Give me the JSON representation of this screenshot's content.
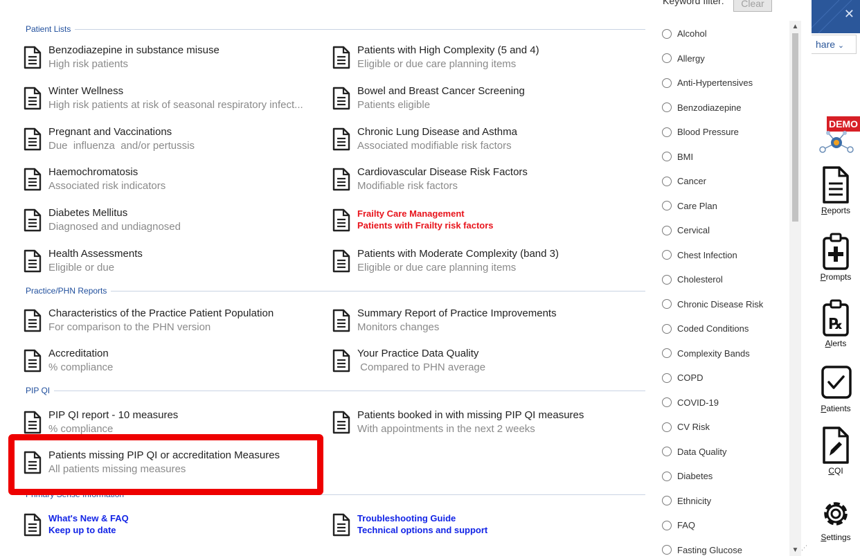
{
  "sections": {
    "patient_lists": "Patient Lists",
    "practice_phn": "Practice/PHN Reports",
    "pip_qi": "PIP QI",
    "primary_sense": "Primary Sense Information"
  },
  "reports": {
    "benzo": {
      "title": "Benzodiazepine in substance misuse",
      "subtitle": "High risk patients"
    },
    "winter": {
      "title": "Winter Wellness",
      "subtitle": "High risk patients at risk of seasonal respiratory infect..."
    },
    "pregnant": {
      "title": "Pregnant and Vaccinations",
      "subtitle": "Due  influenza  and/or pertussis"
    },
    "haemo": {
      "title": "Haemochromatosis",
      "subtitle": "Associated risk indicators"
    },
    "diabetes": {
      "title": "Diabetes Mellitus",
      "subtitle": "Diagnosed and undiagnosed"
    },
    "health_assess": {
      "title": "Health Assessments",
      "subtitle": "Eligible or due"
    },
    "high_complexity": {
      "title": "Patients with High Complexity (5 and 4)",
      "subtitle": "Eligible or due care planning items"
    },
    "bowel_breast": {
      "title": "Bowel and Breast Cancer Screening",
      "subtitle": "Patients eligible"
    },
    "chronic_lung": {
      "title": "Chronic Lung Disease and Asthma",
      "subtitle": "Associated modifiable risk factors"
    },
    "cvd_risk": {
      "title": "Cardiovascular Disease Risk Factors",
      "subtitle": "Modifiable risk factors"
    },
    "frailty": {
      "title": "Frailty Care Management",
      "subtitle": "Patients with Frailty risk factors"
    },
    "moderate_complexity": {
      "title": "Patients with Moderate Complexity (band 3)",
      "subtitle": "Eligible or due care planning items"
    },
    "characteristics": {
      "title": "Characteristics of the Practice Patient Population",
      "subtitle": "For comparison to the PHN version"
    },
    "accreditation": {
      "title": "Accreditation",
      "subtitle": "% compliance"
    },
    "summary_improvements": {
      "title": "Summary Report of Practice Improvements",
      "subtitle": "Monitors changes"
    },
    "data_quality": {
      "title": "Your Practice Data Quality",
      "subtitle": " Compared to PHN average"
    },
    "pip_qi_report": {
      "title": "PIP QI report - 10 measures",
      "subtitle": "% compliance"
    },
    "pip_missing": {
      "title": "Patients missing PIP QI or accreditation Measures",
      "subtitle": "All patients missing measures"
    },
    "pip_booked": {
      "title": "Patients booked in with missing PIP QI measures",
      "subtitle": "With appointments in the next 2 weeks"
    },
    "whats_new": {
      "title": "What's New & FAQ",
      "subtitle": "Keep up to date"
    },
    "troubleshooting": {
      "title": "Troubleshooting Guide",
      "subtitle": "Technical options and support"
    }
  },
  "filter": {
    "label": "Keyword filter:",
    "clear_label": "Clear",
    "keywords": [
      "Alcohol",
      "Allergy",
      "Anti-Hypertensives",
      "Benzodiazepine",
      "Blood Pressure",
      "BMI",
      "Cancer",
      "Care Plan",
      "Cervical",
      "Chest Infection",
      "Cholesterol",
      "Chronic Disease Risk",
      "Coded Conditions",
      "Complexity Bands",
      "COPD",
      "COVID-19",
      "CV Risk",
      "Data Quality",
      "Diabetes",
      "Ethnicity",
      "FAQ",
      "Fasting Glucose"
    ]
  },
  "toolbar": {
    "share_label": "hare",
    "demo_badge": "DEMO",
    "reports_rest": "eports",
    "prompts_rest": "rompts",
    "alerts_rest": "lerts",
    "patients_rest": "atients",
    "cqi_rest": "QI",
    "settings_rest": "ettings"
  },
  "icons": {
    "report": "document-icon",
    "close": "close-icon",
    "share_chevron": "chevron-down-icon",
    "prompts": "clipboard-plus-icon",
    "alerts": "clipboard-rx-icon",
    "patients": "checkbox-icon",
    "cqi": "document-pen-icon",
    "settings": "gear-icon"
  },
  "colors": {
    "section_header": "#1f4e9c",
    "highlight": "#ee0000",
    "red_report": "#e8141c",
    "blue_report": "#1224e6",
    "demo_badge": "#d71f26"
  }
}
